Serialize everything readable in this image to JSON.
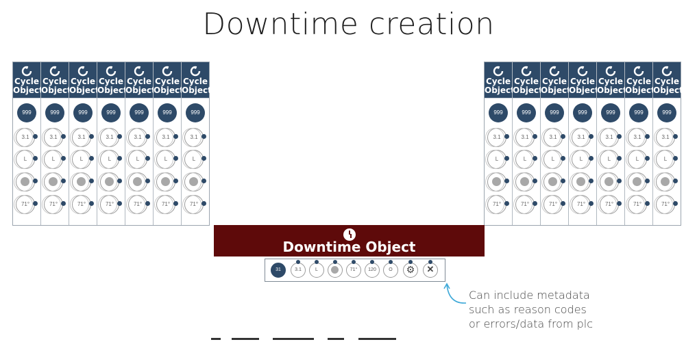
{
  "title": "Downtime creation",
  "cycle_column": {
    "line1": "Cycle",
    "line2": "Object",
    "badge": "999",
    "rows": [
      "3.1",
      "L",
      "",
      "71°"
    ]
  },
  "left_panel_count": 7,
  "right_panel_count": 7,
  "downtime": {
    "label": "Downtime Object",
    "metadata_items": [
      "31",
      "3.1",
      "L",
      "",
      "71°",
      "120",
      "O",
      "gear-icon",
      "close-icon"
    ]
  },
  "note": {
    "lines": [
      "Can include metadata",
      "such as reason codes",
      "or errors/data from plc"
    ]
  },
  "colors": {
    "navy": "#2e4a68",
    "maroon": "#5e0a0a",
    "arrow": "#3fa9d8"
  }
}
